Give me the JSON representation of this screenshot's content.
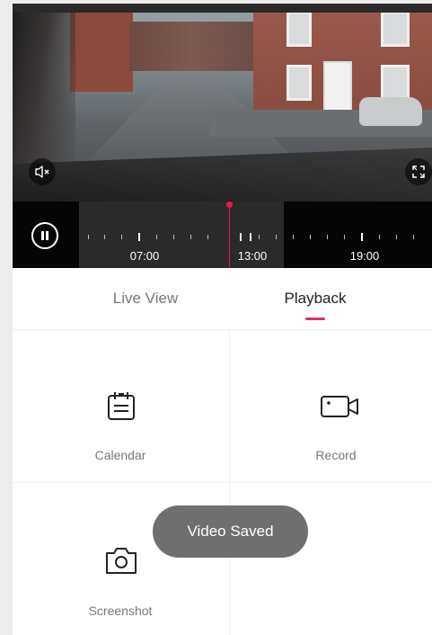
{
  "video": {
    "mute_icon": "speaker-muted-icon",
    "fullscreen_icon": "fullscreen-icon"
  },
  "timeline": {
    "play_state_icon": "pause-icon",
    "labels": [
      "07:00",
      "13:00",
      "19:00"
    ],
    "cursor_color": "#e8194a"
  },
  "tabs": [
    {
      "label": "Live View",
      "active": false
    },
    {
      "label": "Playback",
      "active": true
    }
  ],
  "accent_color": "#e0306b",
  "menu": [
    {
      "label": "Calendar",
      "icon": "calendar-icon"
    },
    {
      "label": "Record",
      "icon": "video-camera-icon"
    },
    {
      "label": "Screenshot",
      "icon": "camera-icon"
    }
  ],
  "toast": {
    "text": "Video Saved"
  }
}
